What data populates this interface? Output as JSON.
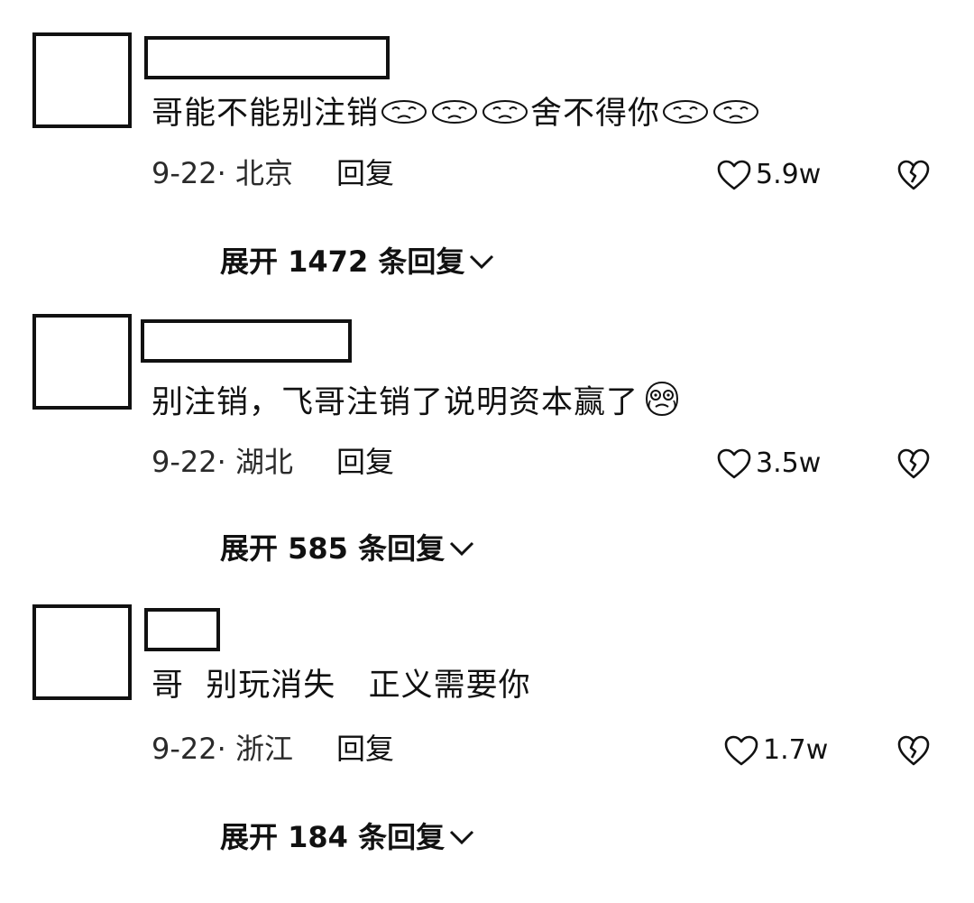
{
  "comments": [
    {
      "text_before": "哥能不能别注销",
      "text_after": "舍不得你",
      "date_location": "9-22· 北京",
      "reply_label": "回复",
      "likes": "5.9w",
      "expand_label": "展开 1472 条回复"
    },
    {
      "text": "别注销，飞哥注销了说明资本赢了",
      "date_location": "9-22· 湖北",
      "reply_label": "回复",
      "likes": "3.5w",
      "expand_label": "展开 585 条回复"
    },
    {
      "text": "哥  别玩消失   正义需要你",
      "date_location": "9-22· 浙江",
      "reply_label": "回复",
      "likes": "1.7w",
      "expand_label": "展开 184 条回复"
    }
  ],
  "icons": {
    "like": "heart-outline-icon",
    "dislike": "broken-heart-icon",
    "expand": "chevron-down-icon",
    "emoji_sad": "sad-face-emoji",
    "emoji_cry": "crying-face-emoji"
  },
  "colors": {
    "text": "#111111",
    "background": "#ffffff"
  }
}
